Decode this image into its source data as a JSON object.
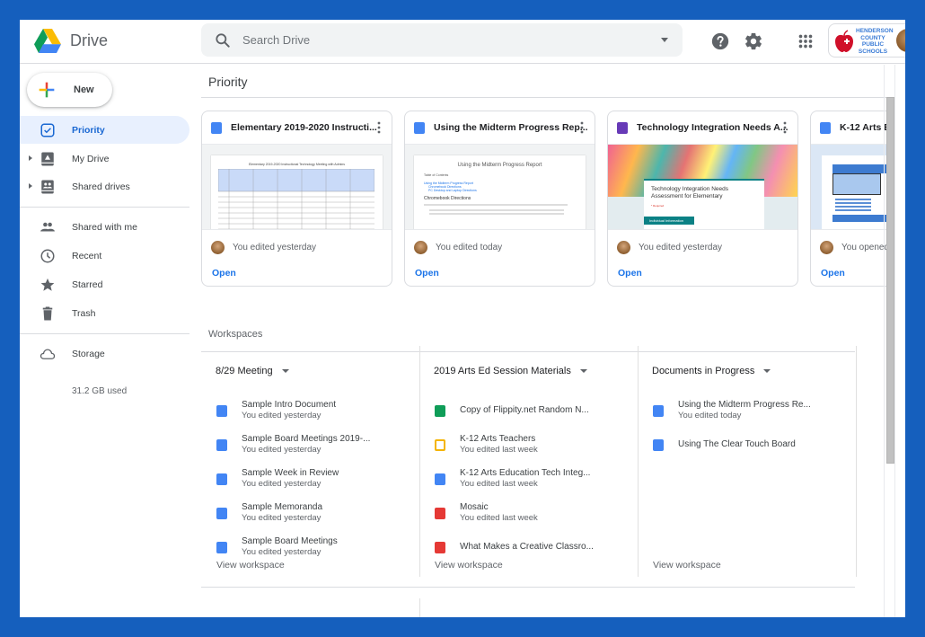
{
  "app": {
    "name": "Drive",
    "search_placeholder": "Search Drive",
    "org_name_lines": [
      "HENDERSON",
      "COUNTY",
      "PUBLIC",
      "SCHOOLS"
    ]
  },
  "header_icons": [
    "help-icon",
    "settings-icon",
    "apps-grid-icon"
  ],
  "sidebar": {
    "new_label": "New",
    "items": [
      {
        "label": "Priority",
        "icon": "priority-check-icon",
        "active": true
      },
      {
        "label": "My Drive",
        "icon": "my-drive-icon",
        "expandable": true
      },
      {
        "label": "Shared drives",
        "icon": "shared-drives-icon",
        "expandable": true
      },
      {
        "label": "Shared with me",
        "icon": "people-icon"
      },
      {
        "label": "Recent",
        "icon": "clock-icon"
      },
      {
        "label": "Starred",
        "icon": "star-icon"
      },
      {
        "label": "Trash",
        "icon": "trash-icon"
      },
      {
        "label": "Storage",
        "icon": "cloud-icon"
      }
    ],
    "storage_used": "31.2 GB used"
  },
  "main": {
    "priority_title": "Priority",
    "cards": [
      {
        "title": "Elementary 2019-2020 Instructi...",
        "type": "doc",
        "meta": "You edited yesterday",
        "action": "Open",
        "thumb_title": "Elementary 2019-2020 Instructional Technology Meeting with Admins"
      },
      {
        "title": "Using the Midterm Progress Rep...",
        "type": "doc",
        "meta": "You edited today",
        "action": "Open",
        "thumb_title": "Using the Midterm Progress Report",
        "thumb_toc": "Table of Contents",
        "thumb_links": [
          "Using the Midterm Progress Report",
          "Chromebook Directions",
          "PC Desktop and Laptop Directions"
        ],
        "thumb_heading": "Chromebook Directions"
      },
      {
        "title": "Technology Integration Needs A...",
        "type": "form",
        "meta": "You edited yesterday",
        "action": "Open",
        "thumb_title": "Technology Integration Needs Assessment for Elementary",
        "thumb_required": "* Required",
        "thumb_section": "Individual Information"
      },
      {
        "title": "K-12 Arts E",
        "type": "doc",
        "meta": "You opened",
        "action": "Open"
      }
    ],
    "workspaces_title": "Workspaces",
    "workspaces": [
      {
        "name": "8/29 Meeting",
        "files": [
          {
            "name": "Sample Intro Document",
            "type": "doc",
            "sub": "You edited yesterday"
          },
          {
            "name": "Sample Board Meetings 2019-...",
            "type": "doc",
            "sub": "You edited yesterday"
          },
          {
            "name": "Sample Week in Review",
            "type": "doc",
            "sub": "You edited yesterday"
          },
          {
            "name": "Sample Memoranda",
            "type": "doc",
            "sub": "You edited yesterday"
          },
          {
            "name": "Sample Board Meetings",
            "type": "doc",
            "sub": "You edited yesterday"
          }
        ],
        "view_label": "View workspace"
      },
      {
        "name": "2019 Arts Ed Session Materials",
        "files": [
          {
            "name": "Copy of Flippity.net Random N...",
            "type": "sheet",
            "sub": ""
          },
          {
            "name": "K-12 Arts Teachers",
            "type": "slides",
            "sub": "You edited last week"
          },
          {
            "name": "K-12 Arts Education Tech Integ...",
            "type": "doc",
            "sub": "You edited last week"
          },
          {
            "name": "Mosaic",
            "type": "jamboard",
            "sub": "You edited last week"
          },
          {
            "name": "What Makes a Creative Classro...",
            "type": "jamboard",
            "sub": ""
          }
        ],
        "view_label": "View workspace"
      },
      {
        "name": "Documents in Progress",
        "files": [
          {
            "name": "Using the Midterm Progress Re...",
            "type": "doc",
            "sub": "You edited today"
          },
          {
            "name": "Using The Clear Touch Board",
            "type": "doc",
            "sub": ""
          }
        ],
        "view_label": "View workspace"
      }
    ]
  },
  "colors": {
    "frame": "#155fbd",
    "accent": "#1a73e8",
    "active_bg": "#e8f0fe",
    "doc": "#4285f4",
    "sheet": "#0f9d58",
    "slides": "#f4b400",
    "form": "#673ab7",
    "jamboard": "#e53935"
  }
}
